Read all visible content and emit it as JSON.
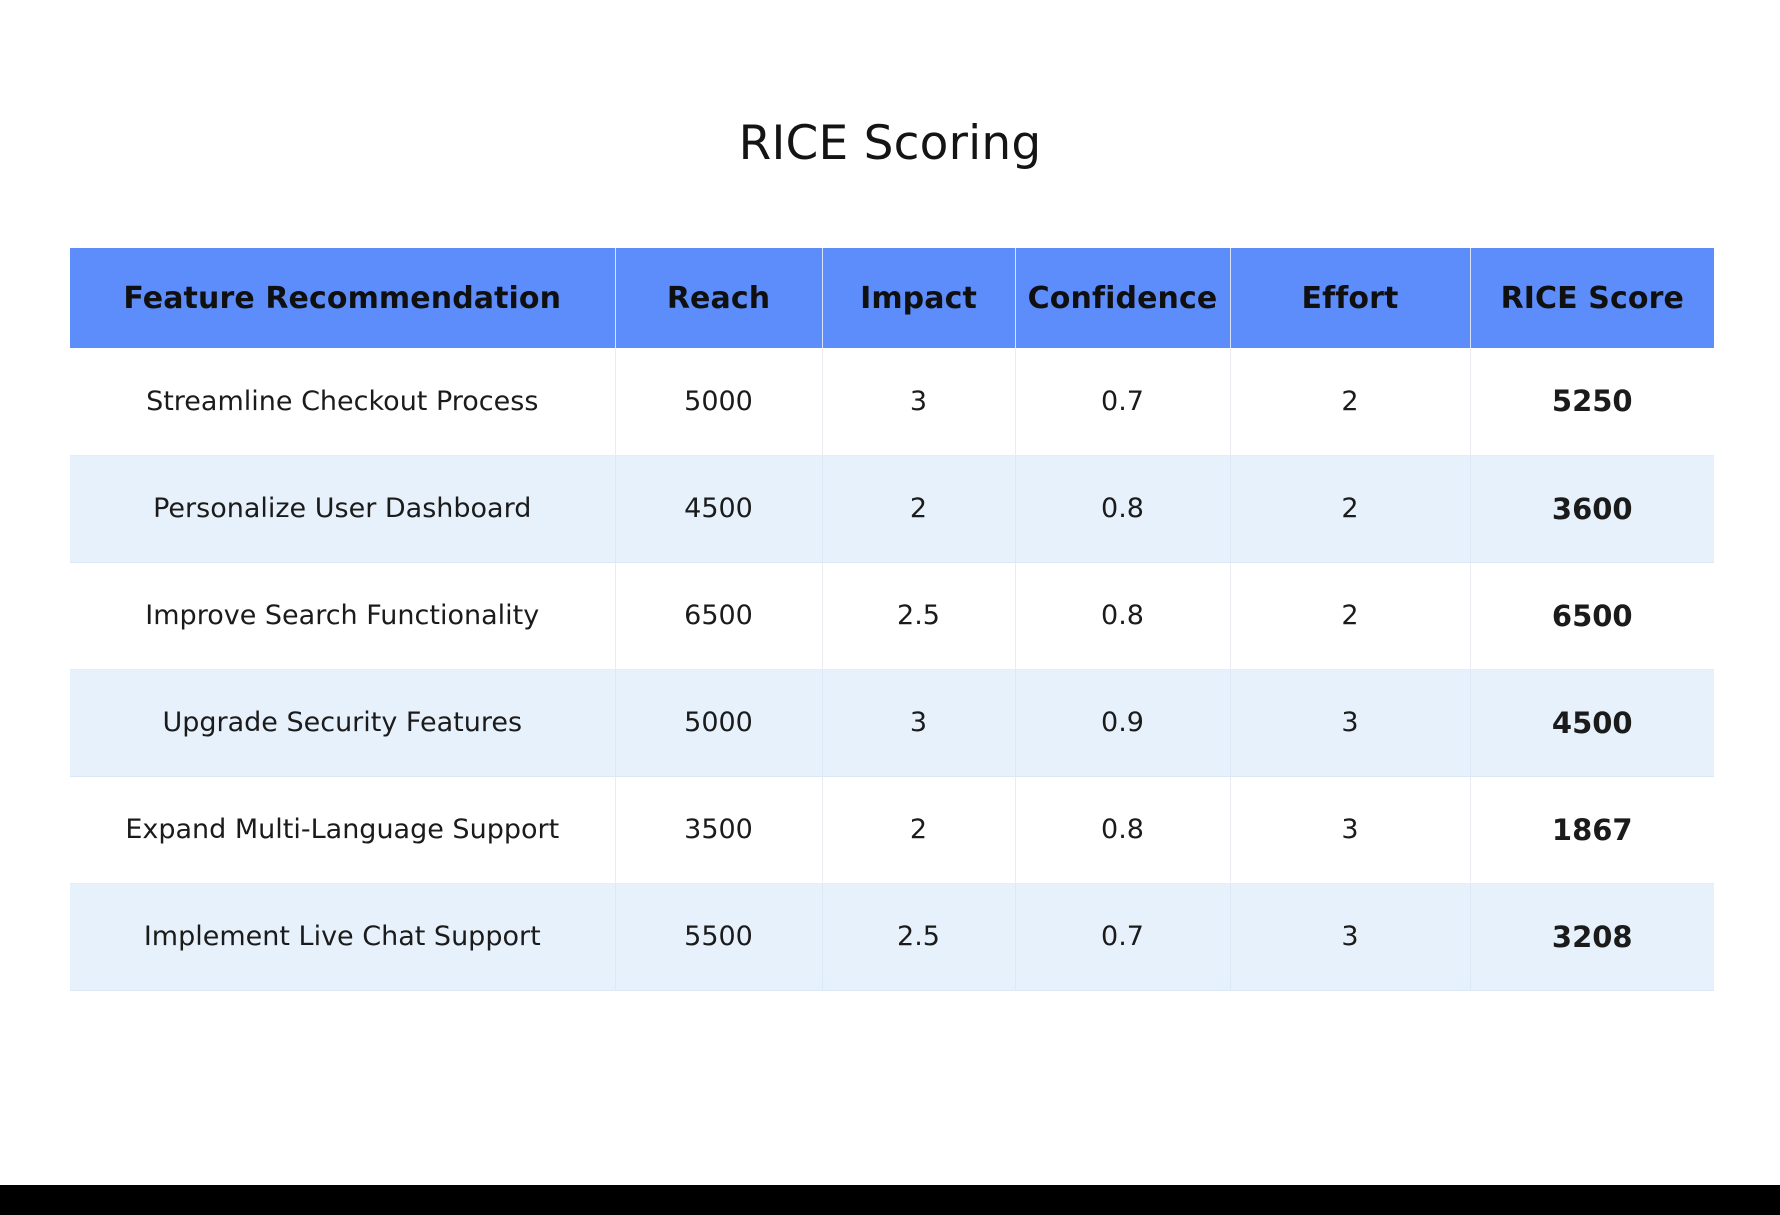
{
  "title": "RICE Scoring",
  "table": {
    "columns": [
      {
        "key": "feature",
        "label": "Feature Recommendation"
      },
      {
        "key": "reach",
        "label": "Reach"
      },
      {
        "key": "impact",
        "label": "Impact"
      },
      {
        "key": "confidence",
        "label": "Confidence"
      },
      {
        "key": "effort",
        "label": "Effort"
      },
      {
        "key": "score",
        "label": "RICE Score"
      }
    ],
    "rows": [
      {
        "feature": "Streamline Checkout Process",
        "reach": "5000",
        "impact": "3",
        "confidence": "0.7",
        "effort": "2",
        "score": "5250"
      },
      {
        "feature": "Personalize User Dashboard",
        "reach": "4500",
        "impact": "2",
        "confidence": "0.8",
        "effort": "2",
        "score": "3600"
      },
      {
        "feature": "Improve Search Functionality",
        "reach": "6500",
        "impact": "2.5",
        "confidence": "0.8",
        "effort": "2",
        "score": "6500"
      },
      {
        "feature": "Upgrade Security Features",
        "reach": "5000",
        "impact": "3",
        "confidence": "0.9",
        "effort": "3",
        "score": "4500"
      },
      {
        "feature": "Expand Multi-Language Support",
        "reach": "3500",
        "impact": "2",
        "confidence": "0.8",
        "effort": "3",
        "score": "1867"
      },
      {
        "feature": "Implement Live Chat Support",
        "reach": "5500",
        "impact": "2.5",
        "confidence": "0.7",
        "effort": "3",
        "score": "3208"
      }
    ]
  },
  "colors": {
    "header_background": "#5c8dfa",
    "header_text": "#101010",
    "row_even_background": "#ffffff",
    "row_odd_background": "#e7f1fb",
    "grid_line": "#e9edf2",
    "page_background": "#ffffff",
    "bottom_bar": "#000000",
    "title_text": "#141414"
  },
  "chart_data": {
    "type": "table",
    "title": "RICE Scoring",
    "columns": [
      "Feature Recommendation",
      "Reach",
      "Impact",
      "Confidence",
      "Effort",
      "RICE Score"
    ],
    "rows": [
      [
        "Streamline Checkout Process",
        5000,
        3,
        0.7,
        2,
        5250
      ],
      [
        "Personalize User Dashboard",
        4500,
        2,
        0.8,
        2,
        3600
      ],
      [
        "Improve Search Functionality",
        6500,
        2.5,
        0.8,
        2,
        6500
      ],
      [
        "Upgrade Security Features",
        5000,
        3,
        0.9,
        3,
        4500
      ],
      [
        "Expand Multi-Language Support",
        3500,
        2,
        0.8,
        3,
        1867
      ],
      [
        "Implement Live Chat Support",
        5500,
        2.5,
        0.7,
        3,
        3208
      ]
    ]
  }
}
